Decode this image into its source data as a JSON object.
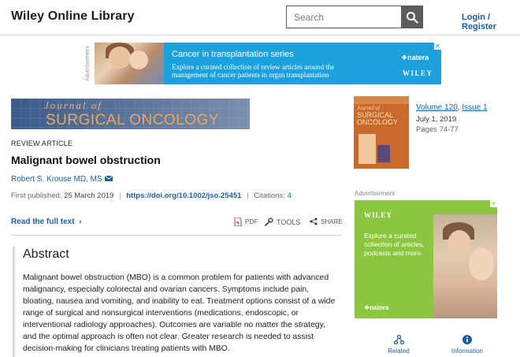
{
  "header": {
    "logo": "Wiley Online Library",
    "search_placeholder": "Search",
    "login": "Login / Register"
  },
  "top_ad": {
    "label": "Advertisement",
    "title": "Cancer in transplantation series",
    "subtitle_line1": "Explore a curated collection of review articles around the",
    "subtitle_line2": "management of cancer patients in organ transplantation",
    "sponsor": "natera",
    "publisher": "WILEY",
    "close": "✕"
  },
  "journal_banner": {
    "line1": "Journal of",
    "line2": "SURGICAL ONCOLOGY"
  },
  "article": {
    "type": "REVIEW ARTICLE",
    "title": "Malignant bowel obstruction",
    "author": "Robert S. Krouse MD, MS",
    "first_published_label": "First published:",
    "first_published_date": "25 March 2019",
    "doi": "https://doi.org/10.1002/jso.25451",
    "citations_label": "Citations:",
    "citations_count": "4"
  },
  "actions": {
    "read_full": "Read the full text",
    "pdf": "PDF",
    "tools": "TOOLS",
    "share": "SHARE"
  },
  "abstract": {
    "heading": "Abstract",
    "text": "Malignant bowel obstruction (MBO) is a common problem for patients with advanced malignancy, especially colorectal and ovarian cancers. Symptoms include pain, bloating, nausea and vomiting, and inability to eat. Treatment options consist of a wide range of surgical and nonsurgical interventions (medications, endoscopic, or interventional radiology approaches). Outcomes are variable no matter the strategy, and the optimal approach is often not clear. Greater research is needed to assist decision-making for clinicians treating patients with MBO."
  },
  "issue": {
    "cover_line1": "Journal of",
    "cover_line2": "SURGICAL ONCOLOGY",
    "volume_prefix": "Volume",
    "volume": "120",
    "issue_prefix": "Issue",
    "issue_number": "1",
    "date": "July 1, 2019",
    "pages": "Pages 74-77"
  },
  "side_ad": {
    "label": "Advertisement",
    "publisher": "WILEY",
    "text": "Explore a curated collection of articles, podcasts and more.",
    "sponsor": "natera",
    "close": "✕"
  },
  "side_nav": {
    "related": "Related",
    "information": "Information"
  },
  "colors": {
    "link": "#1b5f9e",
    "top_ad_bg": "#1ea0dc",
    "side_ad_bg": "#8cc63f"
  }
}
